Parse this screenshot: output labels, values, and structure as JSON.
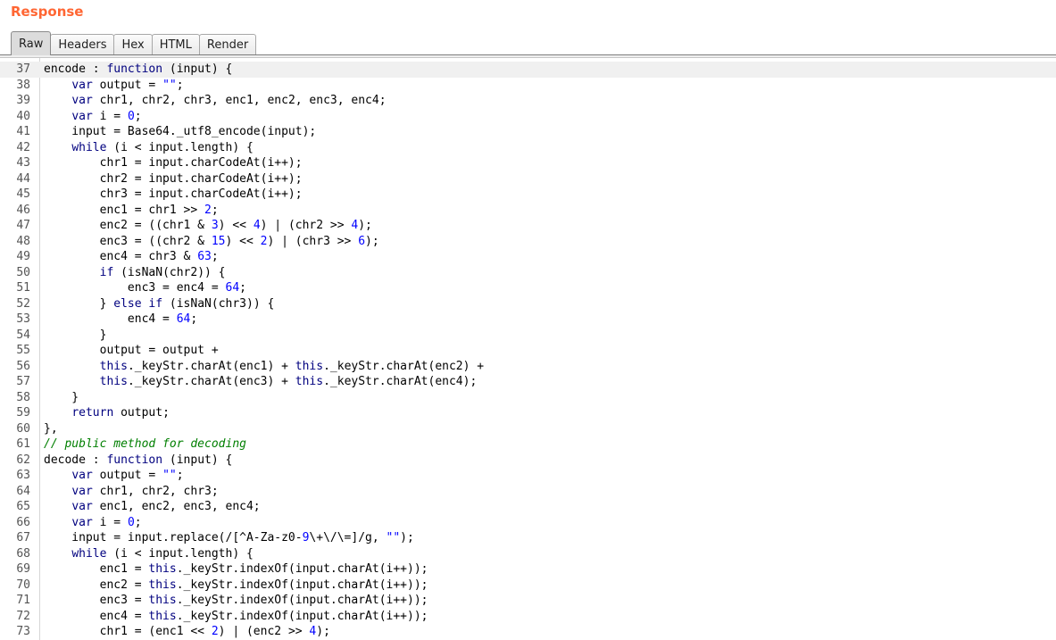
{
  "panel": {
    "title": "Response"
  },
  "tabs": [
    {
      "label": "Raw",
      "active": true
    },
    {
      "label": "Headers",
      "active": false
    },
    {
      "label": "Hex",
      "active": false
    },
    {
      "label": "HTML",
      "active": false
    },
    {
      "label": "Render",
      "active": false
    }
  ],
  "colors": {
    "header": "#ff6633",
    "keyword": "#00007f",
    "number": "#0000ff",
    "comment": "#007f00"
  },
  "editor": {
    "lines": [
      {
        "n": "37",
        "t": "encode : function (input) {"
      },
      {
        "n": "38",
        "t": "    var output = \"\";"
      },
      {
        "n": "39",
        "t": "    var chr1, chr2, chr3, enc1, enc2, enc3, enc4;"
      },
      {
        "n": "40",
        "t": "    var i = 0;"
      },
      {
        "n": "41",
        "t": "    input = Base64._utf8_encode(input);"
      },
      {
        "n": "42",
        "t": "    while (i < input.length) {"
      },
      {
        "n": "43",
        "t": "        chr1 = input.charCodeAt(i++);"
      },
      {
        "n": "44",
        "t": "        chr2 = input.charCodeAt(i++);"
      },
      {
        "n": "45",
        "t": "        chr3 = input.charCodeAt(i++);"
      },
      {
        "n": "46",
        "t": "        enc1 = chr1 >> 2;"
      },
      {
        "n": "47",
        "t": "        enc2 = ((chr1 & 3) << 4) | (chr2 >> 4);"
      },
      {
        "n": "48",
        "t": "        enc3 = ((chr2 & 15) << 2) | (chr3 >> 6);"
      },
      {
        "n": "49",
        "t": "        enc4 = chr3 & 63;"
      },
      {
        "n": "50",
        "t": "        if (isNaN(chr2)) {"
      },
      {
        "n": "51",
        "t": "            enc3 = enc4 = 64;"
      },
      {
        "n": "52",
        "t": "        } else if (isNaN(chr3)) {"
      },
      {
        "n": "53",
        "t": "            enc4 = 64;"
      },
      {
        "n": "54",
        "t": "        }"
      },
      {
        "n": "55",
        "t": "        output = output +"
      },
      {
        "n": "56",
        "t": "        this._keyStr.charAt(enc1) + this._keyStr.charAt(enc2) +"
      },
      {
        "n": "57",
        "t": "        this._keyStr.charAt(enc3) + this._keyStr.charAt(enc4);"
      },
      {
        "n": "58",
        "t": "    }"
      },
      {
        "n": "59",
        "t": "    return output;"
      },
      {
        "n": "60",
        "t": "},"
      },
      {
        "n": "61",
        "t": "// public method for decoding"
      },
      {
        "n": "62",
        "t": "decode : function (input) {"
      },
      {
        "n": "63",
        "t": "    var output = \"\";"
      },
      {
        "n": "64",
        "t": "    var chr1, chr2, chr3;"
      },
      {
        "n": "65",
        "t": "    var enc1, enc2, enc3, enc4;"
      },
      {
        "n": "66",
        "t": "    var i = 0;"
      },
      {
        "n": "67",
        "t": "    input = input.replace(/[^A-Za-z0-9\\+\\/\\=]/g, \"\");"
      },
      {
        "n": "68",
        "t": "    while (i < input.length) {"
      },
      {
        "n": "69",
        "t": "        enc1 = this._keyStr.indexOf(input.charAt(i++));"
      },
      {
        "n": "70",
        "t": "        enc2 = this._keyStr.indexOf(input.charAt(i++));"
      },
      {
        "n": "71",
        "t": "        enc3 = this._keyStr.indexOf(input.charAt(i++));"
      },
      {
        "n": "72",
        "t": "        enc4 = this._keyStr.indexOf(input.charAt(i++));"
      },
      {
        "n": "73",
        "t": "        chr1 = (enc1 << 2) | (enc2 >> 4);"
      }
    ]
  }
}
